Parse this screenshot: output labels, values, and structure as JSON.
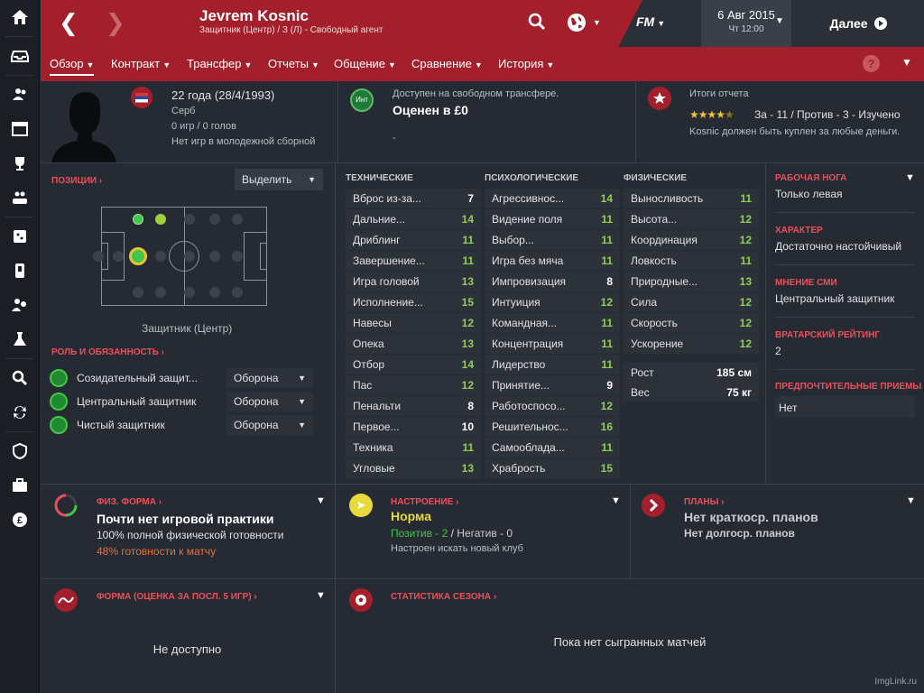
{
  "header": {
    "player_name": "Jevrem Kosnic",
    "player_sub": "Защитник (Центр)  / З (Л) - Свободный агент",
    "game_logo": "FM",
    "date_main": "6 Авг 2015",
    "date_sub": "Чт 12:00",
    "continue_label": "Далее"
  },
  "tabs": [
    {
      "label": "Обзор"
    },
    {
      "label": "Контракт"
    },
    {
      "label": "Трансфер"
    },
    {
      "label": "Отчеты"
    },
    {
      "label": "Общение"
    },
    {
      "label": "Сравнение"
    },
    {
      "label": "История"
    }
  ],
  "help_label": "?",
  "profile": {
    "age": "22 года (28/4/1993)",
    "nationality": "Серб",
    "stats": "0 игр / 0 голов",
    "youth": "Нет игр в молодежной сборной",
    "transfer_note": "Доступен на свободном трансфере.",
    "value": "Оценен в £0",
    "value_icon_label": "Инт",
    "dash": "-",
    "report_title": "Итоги отчета",
    "report_stars": "4.5",
    "report_summary": "За - 11 / Против - 3 - Изучено",
    "report_note": "Kosnic должен быть куплен за любые деньги."
  },
  "positions": {
    "title": "ПОЗИЦИИ",
    "select_label": "Выделить",
    "position_label": "Защитник (Центр)",
    "role_title": "РОЛЬ И ОБЯЗАННОСТЬ",
    "roles": [
      {
        "name": "Созидательный защит...",
        "duty": "Оборона"
      },
      {
        "name": "Центральный защитник",
        "duty": "Оборона"
      },
      {
        "name": "Чистый защитник",
        "duty": "Оборона"
      }
    ]
  },
  "attributes": {
    "technical_title": "ТЕХНИЧЕСКИЕ",
    "mental_title": "ПСИХОЛОГИЧЕСКИЕ",
    "physical_title": "ФИЗИЧЕСКИЕ",
    "technical": [
      {
        "name": "Вброс из-за...",
        "value": "7",
        "c": "w"
      },
      {
        "name": "Дальние...",
        "value": "14",
        "c": "g"
      },
      {
        "name": "Дриблинг",
        "value": "11",
        "c": "g"
      },
      {
        "name": "Завершение...",
        "value": "11",
        "c": "g"
      },
      {
        "name": "Игра головой",
        "value": "13",
        "c": "g"
      },
      {
        "name": "Исполнение...",
        "value": "15",
        "c": "g"
      },
      {
        "name": "Навесы",
        "value": "12",
        "c": "g"
      },
      {
        "name": "Опека",
        "value": "13",
        "c": "g"
      },
      {
        "name": "Отбор",
        "value": "14",
        "c": "g"
      },
      {
        "name": "Пас",
        "value": "12",
        "c": "g"
      },
      {
        "name": "Пенальти",
        "value": "8",
        "c": "w"
      },
      {
        "name": "Первое...",
        "value": "10",
        "c": "w"
      },
      {
        "name": "Техника",
        "value": "11",
        "c": "g"
      },
      {
        "name": "Угловые",
        "value": "13",
        "c": "g"
      }
    ],
    "mental": [
      {
        "name": "Агрессивнос...",
        "value": "14",
        "c": "g"
      },
      {
        "name": "Видение поля",
        "value": "11",
        "c": "g"
      },
      {
        "name": "Выбор...",
        "value": "11",
        "c": "g"
      },
      {
        "name": "Игра без мяча",
        "value": "11",
        "c": "g"
      },
      {
        "name": "Импровизация",
        "value": "8",
        "c": "w"
      },
      {
        "name": "Интуиция",
        "value": "12",
        "c": "g"
      },
      {
        "name": "Командная...",
        "value": "11",
        "c": "g"
      },
      {
        "name": "Концентрация",
        "value": "11",
        "c": "g"
      },
      {
        "name": "Лидерство",
        "value": "11",
        "c": "g"
      },
      {
        "name": "Принятие...",
        "value": "9",
        "c": "w"
      },
      {
        "name": "Работоспосо...",
        "value": "12",
        "c": "g"
      },
      {
        "name": "Решительнос...",
        "value": "16",
        "c": "g"
      },
      {
        "name": "Самооблада...",
        "value": "11",
        "c": "g"
      },
      {
        "name": "Храбрость",
        "value": "15",
        "c": "g"
      }
    ],
    "physical": [
      {
        "name": "Выносливость",
        "value": "11",
        "c": "g"
      },
      {
        "name": "Высота...",
        "value": "12",
        "c": "g"
      },
      {
        "name": "Координация",
        "value": "12",
        "c": "g"
      },
      {
        "name": "Ловкость",
        "value": "11",
        "c": "g"
      },
      {
        "name": "Природные...",
        "value": "13",
        "c": "g"
      },
      {
        "name": "Сила",
        "value": "12",
        "c": "g"
      },
      {
        "name": "Скорость",
        "value": "12",
        "c": "g"
      },
      {
        "name": "Ускорение",
        "value": "12",
        "c": "g"
      }
    ],
    "height_label": "Рост",
    "height_value": "185 см",
    "weight_label": "Вес",
    "weight_value": "75 кг"
  },
  "info": {
    "foot_title": "РАБОЧАЯ НОГА",
    "foot_value": "Только левая",
    "char_title": "ХАРАКТЕР",
    "char_value": "Достаточно настойчивый",
    "media_title": "МНЕНИЕ СМИ",
    "media_value": "Центральный защитник",
    "gk_title": "ВРАТАРСКИЙ РЕЙТИНГ",
    "gk_value": "2",
    "ppm_title": "ПРЕДПОЧТИТЕЛЬНЫЕ ПРИЕМЫ",
    "ppm_value": "Нет"
  },
  "condition": {
    "title": "ФИЗ. ФОРМА",
    "main": "Почти нет игровой практики",
    "line1": "100% полной физической готовности",
    "line2": "48% готовности к матчу"
  },
  "morale": {
    "title": "НАСТРОЕНИЕ",
    "main": "Норма",
    "positive": "Позитив - 2",
    "slash": " / ",
    "negative": "Негатив - 0",
    "note": "Настроен искать новый клуб"
  },
  "plans": {
    "title": "ПЛАНЫ",
    "main": "Нет краткоср. планов",
    "sub": "Нет долгоср. планов"
  },
  "form": {
    "title": "ФОРМА (ОЦЕНКА ЗА ПОСЛ. 5 ИГР)",
    "empty": "Не доступно"
  },
  "season": {
    "title": "СТАТИСТИКА СЕЗОНА",
    "empty": "Пока нет сыгранных матчей"
  },
  "watermark": "ImgLink.ru",
  "colors": {
    "accent": "#a31f2b",
    "good": "#8fd14f",
    "warn": "#e96d3a",
    "morale": "#e8d93c"
  }
}
